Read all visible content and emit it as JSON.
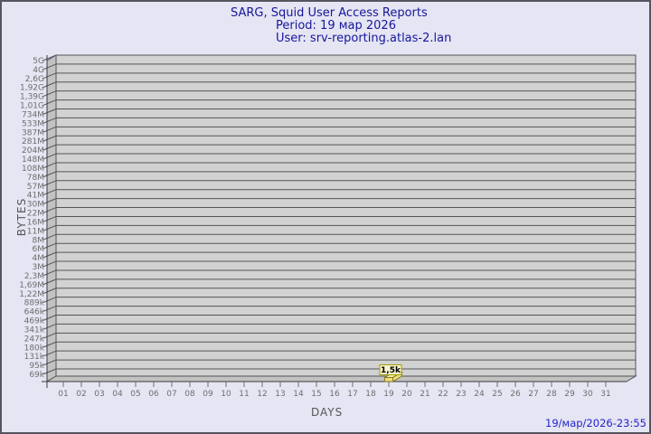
{
  "page": {
    "background_color": "#e5e5f3",
    "border_color": "#55555f"
  },
  "header": {
    "title": "SARG, Squid User Access Reports",
    "period_line": "Period: 19 мар 2026",
    "user_line": "User: srv-reporting.atlas-2.lan"
  },
  "footer": {
    "timestamp": "19/мар/2026-23:55"
  },
  "chart_data": {
    "type": "bar",
    "style": "3d-bar",
    "title": "SARG, Squid User Access Reports",
    "subtitle_lines": [
      "Period: 19 мар 2026",
      "User: srv-reporting.atlas-2.lan"
    ],
    "xlabel": "DAYS",
    "ylabel": "BYTES",
    "grid": true,
    "y_scale_note": "logarithmic-like byte scale, bottom 69k to top 5G",
    "y_tick_labels": [
      "5G",
      "4G",
      "2,6G",
      "1,92G",
      "1,39G",
      "1,01G",
      "734M",
      "533M",
      "387M",
      "281M",
      "204M",
      "148M",
      "108M",
      "78M",
      "57M",
      "41M",
      "30M",
      "22M",
      "16M",
      "11M",
      "8M",
      "6M",
      "4M",
      "3M",
      "2,3M",
      "1,69M",
      "1,22M",
      "889k",
      "646k",
      "469k",
      "341k",
      "247k",
      "180k",
      "131k",
      "95k",
      "69k"
    ],
    "x_categories": [
      "01",
      "02",
      "03",
      "04",
      "05",
      "06",
      "07",
      "08",
      "09",
      "10",
      "11",
      "12",
      "13",
      "14",
      "15",
      "16",
      "17",
      "18",
      "19",
      "20",
      "21",
      "22",
      "23",
      "24",
      "25",
      "26",
      "27",
      "28",
      "29",
      "30",
      "31"
    ],
    "bars": [
      {
        "day": "19",
        "value_label": "1,5k",
        "value_bytes": 1500
      }
    ],
    "colors": {
      "plot_background": "#d2d2d2",
      "wall_side": "#c2c2c2",
      "gridline": "#55555a",
      "axis_line": "#3c3c3c",
      "axis_text": "#6e6e6e",
      "bar_fill": "#eedc82",
      "bar_top_fill": "#f5e9a8",
      "bar_edge": "#7a7000",
      "value_box_fill": "#f8f4ce",
      "value_box_border": "#a0a000",
      "value_text": "#000000"
    }
  }
}
